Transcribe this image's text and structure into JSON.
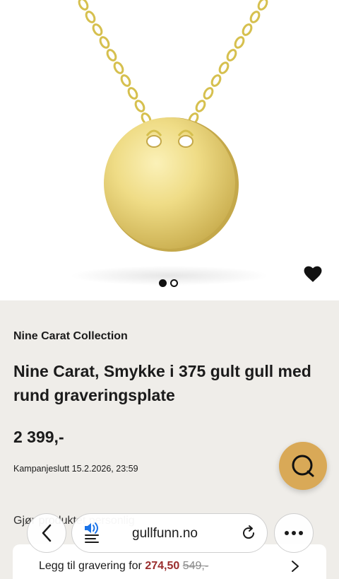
{
  "gallery": {
    "slides_total": 2,
    "active_slide": 1
  },
  "product": {
    "brand": "Nine Carat Collection",
    "title": "Nine Carat, Smykke i 375 gult gull med rund graveringsplate",
    "price": "2 399,-",
    "campaign": "Kampanjeslutt 15.2.2026, 23:59",
    "section_partial": "Gjør produktet personlig"
  },
  "browser": {
    "url": "gullfunn.no"
  },
  "engraving": {
    "label": "Legg til gravering for",
    "price": "274,50",
    "old_price": "549,-"
  },
  "colors": {
    "accent_gold": "#d9a957",
    "sale_red": "#9a2d2d",
    "background": "#efede9"
  },
  "icons": [
    "heart-icon",
    "chat-icon",
    "back-arrow-icon",
    "speaker-icon",
    "menu-lines-icon",
    "reload-icon",
    "more-icon",
    "chevron-right-icon"
  ]
}
